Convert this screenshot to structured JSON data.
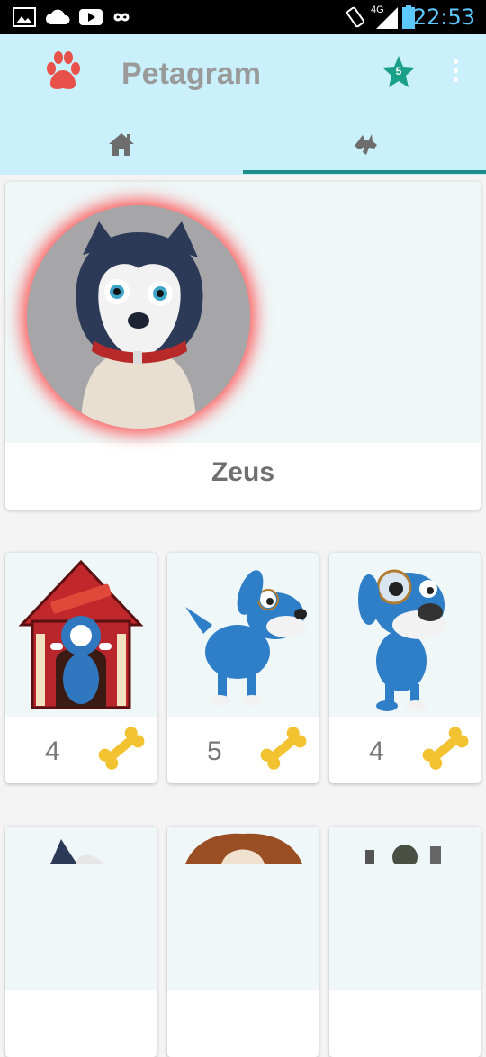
{
  "status_bar": {
    "time": "22:53",
    "network": "4G",
    "icons": [
      "image-icon",
      "cloud-icon",
      "youtube-icon",
      "infinity-icon",
      "vibrate-icon",
      "signal-icon",
      "battery-icon"
    ]
  },
  "app_bar": {
    "title": "Petagram",
    "favorites_count": "5",
    "colors": {
      "background": "#c9f0fb",
      "accent": "#1e8c88",
      "star": "#1aa088",
      "paw": "#e8504a"
    }
  },
  "tabs": [
    {
      "icon": "home-icon",
      "selected": false
    },
    {
      "icon": "dog-icon",
      "selected": true
    }
  ],
  "profile": {
    "name": "Zeus",
    "photo": "husky-puppy-illustration"
  },
  "pets": [
    {
      "rating": "4",
      "image": "dog-in-doghouse",
      "rating_icon": "bone-icon"
    },
    {
      "rating": "5",
      "image": "blue-dog-with-monocle-side",
      "rating_icon": "bone-icon"
    },
    {
      "rating": "4",
      "image": "blue-dog-with-monocle-front",
      "rating_icon": "bone-icon"
    }
  ],
  "pets_row2": [
    {
      "image": "husky-partial"
    },
    {
      "image": "beagle-partial"
    },
    {
      "image": "robot-dog-partial"
    }
  ]
}
